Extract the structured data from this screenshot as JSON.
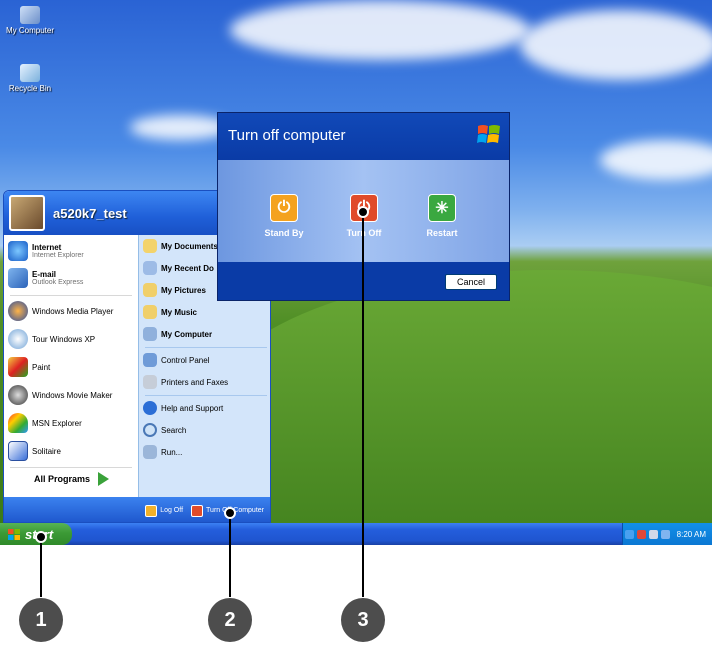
{
  "desktop": {
    "icons": [
      {
        "label": "My Computer",
        "icon": "my-computer-icon"
      },
      {
        "label": "Recycle Bin",
        "icon": "recycle-bin-icon"
      }
    ]
  },
  "start_menu": {
    "user_name": "a520k7_test",
    "pinned": [
      {
        "title": "Internet",
        "subtitle": "Internet Explorer",
        "icon": "internet-explorer-icon"
      },
      {
        "title": "E-mail",
        "subtitle": "Outlook Express",
        "icon": "outlook-express-icon"
      }
    ],
    "recent": [
      {
        "label": "Windows Media Player",
        "icon": "media-player-icon"
      },
      {
        "label": "Tour Windows XP",
        "icon": "tour-xp-icon"
      },
      {
        "label": "Paint",
        "icon": "paint-icon"
      },
      {
        "label": "Windows Movie Maker",
        "icon": "movie-maker-icon"
      },
      {
        "label": "MSN Explorer",
        "icon": "msn-icon"
      },
      {
        "label": "Solitaire",
        "icon": "solitaire-icon"
      }
    ],
    "all_programs": "All Programs",
    "places": [
      {
        "label": "My Documents",
        "icon": "folder-icon"
      },
      {
        "label": "My Recent Do",
        "icon": "recent-docs-icon"
      },
      {
        "label": "My Pictures",
        "icon": "pictures-icon"
      },
      {
        "label": "My Music",
        "icon": "music-icon"
      },
      {
        "label": "My Computer",
        "icon": "my-computer-icon"
      }
    ],
    "settings": [
      {
        "label": "Control Panel",
        "icon": "control-panel-icon"
      },
      {
        "label": "Printers and Faxes",
        "icon": "printer-icon"
      }
    ],
    "tools": [
      {
        "label": "Help and Support",
        "icon": "help-icon"
      },
      {
        "label": "Search",
        "icon": "search-icon"
      },
      {
        "label": "Run...",
        "icon": "run-icon"
      }
    ],
    "footer": {
      "log_off": "Log Off",
      "turn_off": "Turn Off Computer"
    }
  },
  "taskbar": {
    "start_label": "start",
    "clock": "8:20 AM"
  },
  "dialog": {
    "title": "Turn off computer",
    "options": [
      {
        "label": "Stand By",
        "icon": "power-standby-icon",
        "color": "#f4a21f"
      },
      {
        "label": "Turn Off",
        "icon": "power-off-icon",
        "color": "#e04b2a"
      },
      {
        "label": "Restart",
        "icon": "restart-icon",
        "color": "#3aa840"
      }
    ],
    "cancel": "Cancel"
  },
  "callouts": [
    "1",
    "2",
    "3"
  ]
}
